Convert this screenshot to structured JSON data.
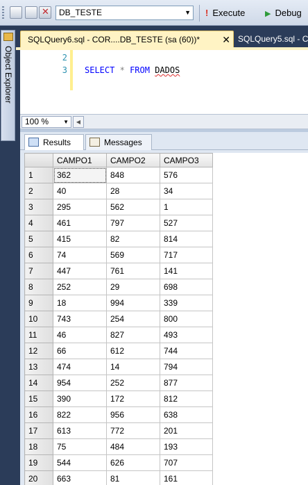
{
  "toolbar": {
    "database": "DB_TESTE",
    "execute_label": "Execute",
    "debug_label": "Debug"
  },
  "sidebar": {
    "object_explorer_label": "Object Explorer"
  },
  "tabs": {
    "active": "SQLQuery6.sql - COR....DB_TESTE (sa (60))*",
    "inactive": "SQLQuery5.sql - C"
  },
  "editor": {
    "line_numbers": [
      "2",
      "3"
    ],
    "select_kw": "SELECT",
    "star": "*",
    "from_kw": "FROM",
    "table": "DADOS"
  },
  "zoom": "100 %",
  "results_tabs": {
    "results": "Results",
    "messages": "Messages"
  },
  "grid": {
    "columns": [
      "CAMPO1",
      "CAMPO2",
      "CAMPO3"
    ],
    "rows": [
      [
        "1",
        "362",
        "848",
        "576"
      ],
      [
        "2",
        "40",
        "28",
        "34"
      ],
      [
        "3",
        "295",
        "562",
        "1"
      ],
      [
        "4",
        "461",
        "797",
        "527"
      ],
      [
        "5",
        "415",
        "82",
        "814"
      ],
      [
        "6",
        "74",
        "569",
        "717"
      ],
      [
        "7",
        "447",
        "761",
        "141"
      ],
      [
        "8",
        "252",
        "29",
        "698"
      ],
      [
        "9",
        "18",
        "994",
        "339"
      ],
      [
        "10",
        "743",
        "254",
        "800"
      ],
      [
        "11",
        "46",
        "827",
        "493"
      ],
      [
        "12",
        "66",
        "612",
        "744"
      ],
      [
        "13",
        "474",
        "14",
        "794"
      ],
      [
        "14",
        "954",
        "252",
        "877"
      ],
      [
        "15",
        "390",
        "172",
        "812"
      ],
      [
        "16",
        "822",
        "956",
        "638"
      ],
      [
        "17",
        "613",
        "772",
        "201"
      ],
      [
        "18",
        "75",
        "484",
        "193"
      ],
      [
        "19",
        "544",
        "626",
        "707"
      ],
      [
        "20",
        "663",
        "81",
        "161"
      ]
    ]
  }
}
